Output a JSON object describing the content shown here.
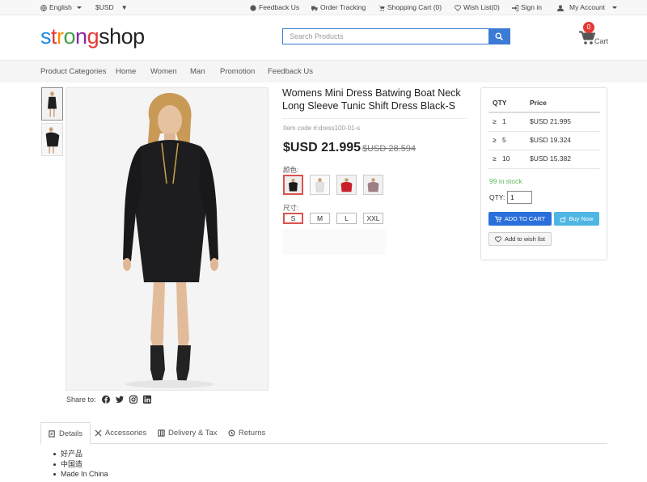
{
  "topbar": {
    "language": "English",
    "currency": "$USD",
    "links": {
      "feedback": "Feedback Us",
      "order_tracking": "Order Tracking",
      "cart": "Shopping Cart (0)",
      "wishlist": "Wish List(0)",
      "signin": "Sign in",
      "account": "My Account"
    }
  },
  "header": {
    "logo": {
      "letters": [
        "s",
        "t",
        "r",
        "o",
        "n",
        "g",
        "s",
        "h",
        "o",
        "p"
      ],
      "colors": [
        "#1e88e5",
        "#e53935",
        "#fb8c00",
        "#43a047",
        "#8e24aa",
        "#e53935",
        "#222222",
        "#222222",
        "#222222",
        "#222222"
      ]
    },
    "search_placeholder": "Search Products",
    "cart_count": "0",
    "cart_label": "Cart"
  },
  "nav": {
    "items": [
      "Product Categories",
      "Home",
      "Women",
      "Man",
      "Promotion",
      "Feedback Us"
    ]
  },
  "gallery": {
    "thumbnails": [
      "front-view",
      "side-view"
    ],
    "main_image": "woman-in-black-dress"
  },
  "share": {
    "label": "Share to:",
    "icons": [
      "facebook-icon",
      "twitter-icon",
      "instagram-icon",
      "linkedin-icon"
    ]
  },
  "product": {
    "title": "Womens Mini Dress Batwing Boat Neck Long Sleeve Tunic Shift Dress Black-S",
    "item_code": "Item code #:dress100-01-s",
    "price": "$USD 21.995",
    "old_price": "$USD 28.594",
    "color_label": "颜色:",
    "colors": [
      {
        "name": "black",
        "hex": "#1c1c1c",
        "selected": true
      },
      {
        "name": "white",
        "hex": "#e8e8e8",
        "selected": false
      },
      {
        "name": "red",
        "hex": "#c8202a",
        "selected": false
      },
      {
        "name": "mauve",
        "hex": "#a07e86",
        "selected": false
      }
    ],
    "size_label": "尺寸:",
    "sizes": [
      "S",
      "M",
      "L",
      "XXL"
    ],
    "selected_size": "S"
  },
  "price_panel": {
    "headers": [
      "QTY",
      "Price"
    ],
    "rows": [
      {
        "sign": "≥",
        "qty": "1",
        "price": "$USD 21.995"
      },
      {
        "sign": "≥",
        "qty": "5",
        "price": "$USD 19.324"
      },
      {
        "sign": "≥",
        "qty": "10",
        "price": "$USD 15.382"
      }
    ],
    "stock": "99 in stock",
    "qty_label": "QTY:",
    "qty_value": "1",
    "add_to_cart": "ADD TO CART",
    "buy_now": "Buy Now",
    "add_to_wishlist": "Add to wish list"
  },
  "tabs": {
    "items": [
      "Details",
      "Accessories",
      "Delivery & Tax",
      "Returns"
    ],
    "active": "Details"
  },
  "details": {
    "lines": [
      "好产品",
      "中国造",
      "Made In China"
    ]
  },
  "colors": {
    "primary": "#2a6fdb",
    "buy_now": "#4fb6e3",
    "stock": "#5cb85c",
    "badge": "#e53935",
    "selected_border": "#d9534f"
  }
}
